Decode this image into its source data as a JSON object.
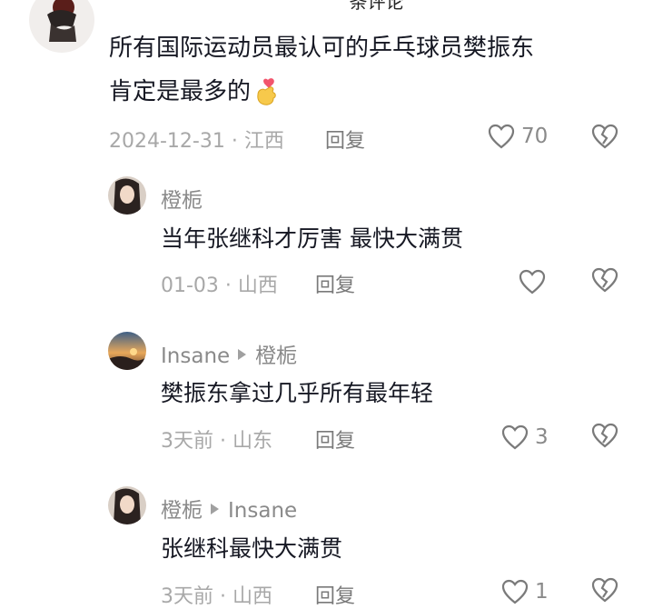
{
  "header": {
    "title": "条评论"
  },
  "comments": [
    {
      "text_line1": "所有国际运动员最认可的乒乓球员樊振东",
      "text_line2": "肯定是最多的",
      "emoji": "finger-heart-emoji",
      "date": "2024-12-31 · 江西",
      "reply_label": "回复",
      "likes": "70"
    },
    {
      "author": "橙栀",
      "text": "当年张继科才厉害 最快大满贯",
      "date": "01-03 · 山西",
      "reply_label": "回复",
      "likes": ""
    },
    {
      "author": "Insane",
      "reply_to": "橙栀",
      "text": "樊振东拿过几乎所有最年轻",
      "date": "3天前 · 山东",
      "reply_label": "回复",
      "likes": "3"
    },
    {
      "author": "橙栀",
      "reply_to": "Insane",
      "text": "张继科最快大满贯",
      "date": "3天前 · 山西",
      "reply_label": "回复",
      "likes": "1"
    }
  ],
  "colors": {
    "text": "#161823",
    "meta": "#a8a8a8",
    "icon": "#7a7a7a"
  }
}
